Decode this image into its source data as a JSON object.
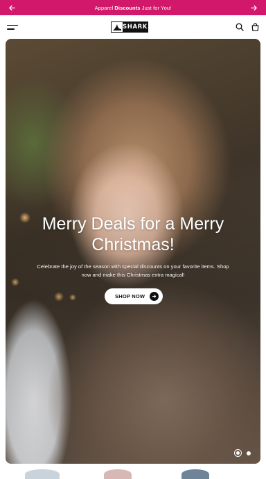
{
  "announcement": {
    "text_before": "Apparel ",
    "text_bold": "Discounts",
    "text_after": " Just for You!",
    "prev_icon": "arrow-left-icon",
    "next_icon": "arrow-right-icon",
    "background": "#d1186a"
  },
  "header": {
    "menu_icon": "hamburger-menu-icon",
    "logo_text": "SHARK",
    "search_icon": "search-icon",
    "cart_icon": "shopping-bag-icon"
  },
  "hero": {
    "title": "Merry Deals for a Merry Christmas!",
    "subtitle": "Celebrate the joy of the season with special discounts on your favorite items. Shop now and make this Christmas extra magical!",
    "cta_label": "SHOP NOW",
    "cta_icon": "arrow-right-icon",
    "slides_total": 2,
    "slide_active": 1
  }
}
